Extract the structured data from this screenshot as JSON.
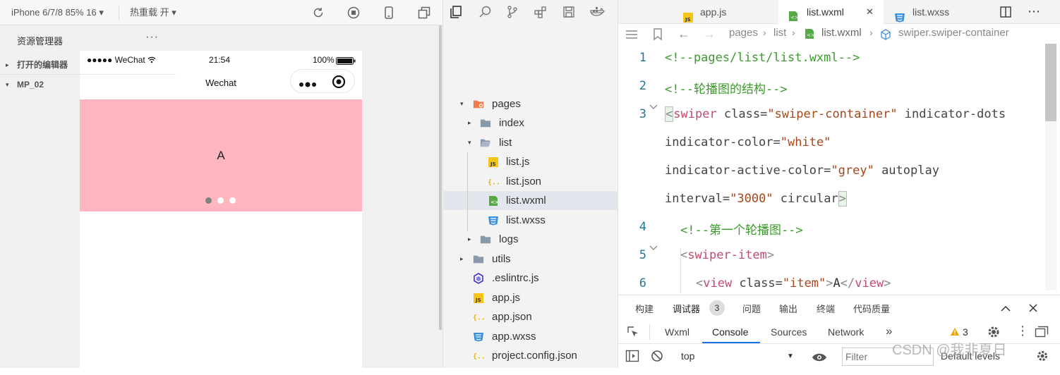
{
  "simulator": {
    "device": "iPhone 6/7/8 85% 16 ▾",
    "hot_reload": "热重载 开 ▾",
    "status": {
      "signal": "●●●●● WeChat",
      "time": "21:54",
      "battery": "100%"
    },
    "nav_title": "Wechat",
    "swiper": {
      "text": "A",
      "color": "#ffb6c1",
      "dots": [
        "active",
        "inactive",
        "inactive"
      ],
      "dot_active": "#808080",
      "dot_inactive": "#ffffff"
    }
  },
  "explorer": {
    "title": "资源管理器",
    "more": "···",
    "open_editors": "打开的编辑器",
    "project": "MP_02",
    "tree": [
      {
        "label": "pages",
        "caret": "▾",
        "icon": "folder-pages-icon"
      },
      {
        "label": "index",
        "caret": "▸",
        "icon": "folder-icon"
      },
      {
        "label": "list",
        "caret": "▾",
        "icon": "folder-open-icon"
      },
      {
        "label": "list.js",
        "caret": "",
        "icon": "js-file-icon"
      },
      {
        "label": "list.json",
        "caret": "",
        "icon": "json-file-icon"
      },
      {
        "label": "list.wxml",
        "caret": "",
        "icon": "wxml-file-icon"
      },
      {
        "label": "list.wxss",
        "caret": "",
        "icon": "wxss-file-icon"
      },
      {
        "label": "logs",
        "caret": "▸",
        "icon": "folder-icon"
      },
      {
        "label": "utils",
        "caret": "▸",
        "icon": "folder-icon"
      },
      {
        "label": ".eslintrc.js",
        "caret": "",
        "icon": "eslint-file-icon"
      },
      {
        "label": "app.js",
        "caret": "",
        "icon": "js-file-icon"
      },
      {
        "label": "app.json",
        "caret": "",
        "icon": "json-file-icon"
      },
      {
        "label": "app.wxss",
        "caret": "",
        "icon": "wxss-file-icon"
      },
      {
        "label": "project.config.json",
        "caret": "",
        "icon": "json-file-icon"
      }
    ]
  },
  "editor": {
    "tabs": [
      {
        "label": "app.js",
        "icon": "js-file-icon"
      },
      {
        "label": "list.wxml",
        "icon": "wxml-file-icon"
      },
      {
        "label": "list.wxss",
        "icon": "wxss-file-icon"
      }
    ],
    "tab_close": "✕",
    "breadcrumb": [
      "pages",
      "list",
      "list.wxml",
      "swiper.swiper-container"
    ],
    "line_numbers": [
      "1",
      "2",
      "3",
      "4",
      "5",
      "6"
    ],
    "code": {
      "l1": "<!--pages/list/list.wxml-->",
      "l2": "<!--轮播图的结构-->",
      "l3_open": "<",
      "l3_tag": "swiper",
      "l3_attr1": " class=",
      "l3_val1": "\"swiper-container\"",
      "l3_attr2": " indicator-dots",
      "l3b_attr": "indicator-color=",
      "l3b_val": "\"white\"",
      "l3c_attr": "indicator-active-color=",
      "l3c_val": "\"grey\"",
      "l3c_attr2": " autoplay",
      "l3d_attr": "interval=",
      "l3d_val": "\"3000\"",
      "l3d_attr2": " circular",
      "l3d_close": ">",
      "l4": "<!--第一个轮播图-->",
      "l5_open": "<",
      "l5_tag": "swiper-item",
      "l5_close": ">",
      "l6_open": "<",
      "l6_tag": "view",
      "l6_attr": " class=",
      "l6_val": "\"item\"",
      "l6_gt": ">",
      "l6_text": "A",
      "l6_end_open": "</",
      "l6_end_tag": "view",
      "l6_end_close": ">"
    }
  },
  "debug": {
    "tabs": [
      "构建",
      "调试器",
      "问题",
      "输出",
      "终端",
      "代码质量"
    ],
    "badge": "3",
    "console_tabs": [
      "Wxml",
      "Console",
      "Sources",
      "Network"
    ],
    "more": "»",
    "warnings": "3",
    "context": "top",
    "filter_placeholder": "Filter",
    "levels": "Default levels"
  },
  "watermark": "CSDN @我非夏日"
}
